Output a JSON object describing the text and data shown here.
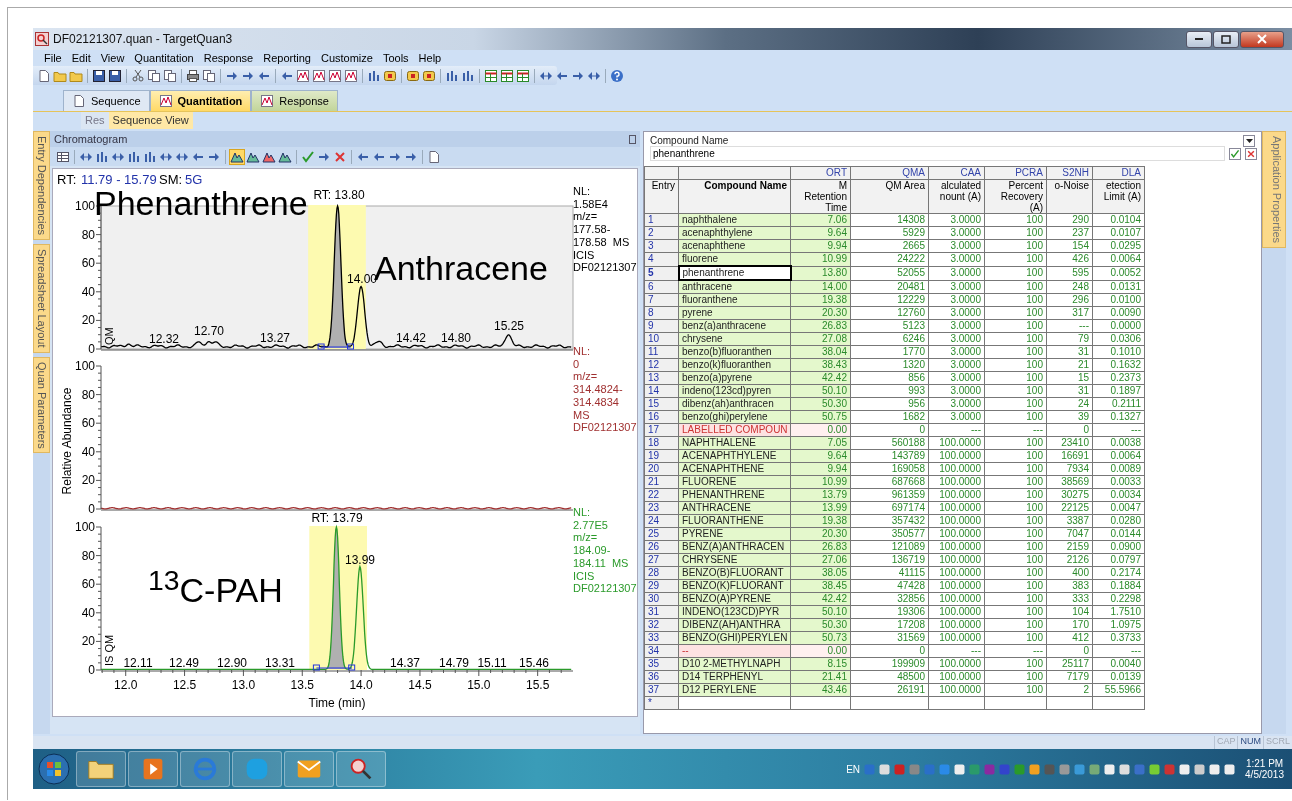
{
  "window": {
    "title": "DF02121307.quan - TargetQuan3"
  },
  "menu": [
    "File",
    "Edit",
    "View",
    "Quantitation",
    "Response",
    "Reporting",
    "Customize",
    "Tools",
    "Help"
  ],
  "tabs": [
    {
      "label": "Sequence",
      "selected": false
    },
    {
      "label": "Quantitation",
      "selected": true
    },
    {
      "label": "Response",
      "selected": false
    }
  ],
  "sub_tabs": [
    {
      "label": "Res",
      "selected": false
    },
    {
      "label": "Sequence View",
      "selected": true
    }
  ],
  "side_tabs": [
    "Entry Dependencies",
    "Spreadsheet Layout",
    "Quan Parameters"
  ],
  "chromatogram": {
    "title": "Chromatogram",
    "range_label": "RT:",
    "range": "11.79 - 15.79",
    "sm_label": "SM:",
    "sm": "5G",
    "ylabel": "Relative Abundance",
    "xlabel": "Time (min)",
    "xticks": [
      "12.0",
      "12.5",
      "13.0",
      "13.5",
      "14.0",
      "14.5",
      "15.0",
      "15.5"
    ],
    "plots": [
      {
        "color": "#000000",
        "yticks": [
          "100",
          "80",
          "60",
          "40",
          "20",
          "0"
        ],
        "axis_label": "QM",
        "rt_label": "RT: 13.80",
        "peak_labels": [
          "14.00",
          "12.32",
          "12.70",
          "13.27",
          "14.42",
          "14.80",
          "15.25"
        ],
        "info": [
          "NL:",
          "1.58E4",
          "m/z=",
          "177.58-",
          "178.58  MS",
          "ICIS",
          "DF02121307"
        ]
      },
      {
        "color": "#a03030",
        "yticks": [
          "100",
          "80",
          "60",
          "40",
          "20",
          "0"
        ],
        "info": [
          "NL:",
          "0",
          "m/z=",
          "314.4824-",
          "314.4834",
          "MS",
          "DF02121307"
        ]
      },
      {
        "color": "#2a9a2a",
        "yticks": [
          "100",
          "80",
          "60",
          "40",
          "20",
          "0"
        ],
        "axis_label": "IS QM",
        "rt_label": "RT: 13.79",
        "peak_labels": [
          "13.99",
          "12.11",
          "12.49",
          "12.90",
          "13.31",
          "14.37",
          "14.79",
          "15.11",
          "15.46"
        ],
        "info": [
          "NL:",
          "2.77E5",
          "m/z=",
          "184.09-",
          "184.11  MS",
          "ICIS",
          "DF02121307"
        ]
      }
    ],
    "annotations": [
      "Phenanthrene",
      "Anthracene",
      "$^{13}$C-PAH"
    ]
  },
  "compound": {
    "label": "Compound Name",
    "value": "phenanthrene"
  },
  "table": {
    "columns": [
      {
        "label": "Entry"
      },
      {
        "label": "Compound Name"
      },
      {
        "code": "ORT",
        "label": "M Retention Time"
      },
      {
        "code": "QMA",
        "label": "QM Area"
      },
      {
        "code": "CAA",
        "label": "alculated nount (A)"
      },
      {
        "code": "PCRA",
        "label": "Percent Recovery (A)"
      },
      {
        "code": "S2NH",
        "label": "o-Noise"
      },
      {
        "code": "DLA",
        "label": "etection Limit (A)"
      }
    ],
    "rows": [
      {
        "entry": "1",
        "name": "naphthalene",
        "values": [
          "7.06",
          "14308",
          "3.0000",
          "100",
          "290",
          "0.0104"
        ],
        "kind": "compound",
        "selected": false
      },
      {
        "entry": "2",
        "name": "acenaphthylene",
        "values": [
          "9.64",
          "5929",
          "3.0000",
          "100",
          "237",
          "0.0107"
        ],
        "kind": "compound",
        "selected": false
      },
      {
        "entry": "3",
        "name": "acenaphthene",
        "values": [
          "9.94",
          "2665",
          "3.0000",
          "100",
          "154",
          "0.0295"
        ],
        "kind": "compound",
        "selected": false
      },
      {
        "entry": "4",
        "name": "fluorene",
        "values": [
          "10.99",
          "24222",
          "3.0000",
          "100",
          "426",
          "0.0064"
        ],
        "kind": "compound",
        "selected": false
      },
      {
        "entry": "5",
        "name": "phenanthrene",
        "values": [
          "13.80",
          "52055",
          "3.0000",
          "100",
          "595",
          "0.0052"
        ],
        "kind": "compound",
        "selected": true
      },
      {
        "entry": "6",
        "name": "anthracene",
        "values": [
          "14.00",
          "20481",
          "3.0000",
          "100",
          "248",
          "0.0131"
        ],
        "kind": "compound",
        "selected": false
      },
      {
        "entry": "7",
        "name": "fluoranthene",
        "values": [
          "19.38",
          "12229",
          "3.0000",
          "100",
          "296",
          "0.0100"
        ],
        "kind": "compound",
        "selected": false
      },
      {
        "entry": "8",
        "name": "pyrene",
        "values": [
          "20.30",
          "12760",
          "3.0000",
          "100",
          "317",
          "0.0090"
        ],
        "kind": "compound",
        "selected": false
      },
      {
        "entry": "9",
        "name": "benz(a)anthracene",
        "values": [
          "26.83",
          "5123",
          "3.0000",
          "100",
          "---",
          "0.0000"
        ],
        "kind": "compound",
        "selected": false
      },
      {
        "entry": "10",
        "name": "chrysene",
        "values": [
          "27.08",
          "6246",
          "3.0000",
          "100",
          "79",
          "0.0306"
        ],
        "kind": "compound",
        "selected": false
      },
      {
        "entry": "11",
        "name": "benzo(b)fluoranthen",
        "values": [
          "38.04",
          "1770",
          "3.0000",
          "100",
          "31",
          "0.1010"
        ],
        "kind": "compound",
        "selected": false
      },
      {
        "entry": "12",
        "name": "benzo(k)fluoranthen",
        "values": [
          "38.43",
          "1320",
          "3.0000",
          "100",
          "21",
          "0.1632"
        ],
        "kind": "compound",
        "selected": false
      },
      {
        "entry": "13",
        "name": "benzo(a)pyrene",
        "values": [
          "42.42",
          "856",
          "3.0000",
          "100",
          "15",
          "0.2373"
        ],
        "kind": "compound",
        "selected": false
      },
      {
        "entry": "14",
        "name": "indeno(123cd)pyren",
        "values": [
          "50.10",
          "993",
          "3.0000",
          "100",
          "31",
          "0.1897"
        ],
        "kind": "compound",
        "selected": false
      },
      {
        "entry": "15",
        "name": "dibenz(ah)anthracen",
        "values": [
          "50.30",
          "956",
          "3.0000",
          "100",
          "24",
          "0.2111"
        ],
        "kind": "compound",
        "selected": false
      },
      {
        "entry": "16",
        "name": "benzo(ghi)perylene",
        "values": [
          "50.75",
          "1682",
          "3.0000",
          "100",
          "39",
          "0.1327"
        ],
        "kind": "compound",
        "selected": false
      },
      {
        "entry": "17",
        "name": "LABELLED COMPOUN",
        "values": [
          "0.00",
          "0",
          "---",
          "---",
          "0",
          "---"
        ],
        "kind": "label",
        "selected": false
      },
      {
        "entry": "18",
        "name": "NAPHTHALENE",
        "values": [
          "7.05",
          "560188",
          "100.0000",
          "100",
          "23410",
          "0.0038"
        ],
        "kind": "compound",
        "selected": false
      },
      {
        "entry": "19",
        "name": "ACENAPHTHYLENE",
        "values": [
          "9.64",
          "143789",
          "100.0000",
          "100",
          "16691",
          "0.0064"
        ],
        "kind": "compound",
        "selected": false
      },
      {
        "entry": "20",
        "name": "ACENAPHTHENE",
        "values": [
          "9.94",
          "169058",
          "100.0000",
          "100",
          "7934",
          "0.0089"
        ],
        "kind": "compound",
        "selected": false
      },
      {
        "entry": "21",
        "name": "FLUORENE",
        "values": [
          "10.99",
          "687668",
          "100.0000",
          "100",
          "38569",
          "0.0033"
        ],
        "kind": "compound",
        "selected": false
      },
      {
        "entry": "22",
        "name": "PHENANTHRENE",
        "values": [
          "13.79",
          "961359",
          "100.0000",
          "100",
          "30275",
          "0.0034"
        ],
        "kind": "compound",
        "selected": false
      },
      {
        "entry": "23",
        "name": "ANTHRACENE",
        "values": [
          "13.99",
          "697174",
          "100.0000",
          "100",
          "22125",
          "0.0047"
        ],
        "kind": "compound",
        "selected": false
      },
      {
        "entry": "24",
        "name": "FLUORANTHENE",
        "values": [
          "19.38",
          "357432",
          "100.0000",
          "100",
          "3387",
          "0.0280"
        ],
        "kind": "compound",
        "selected": false
      },
      {
        "entry": "25",
        "name": "PYRENE",
        "values": [
          "20.30",
          "350577",
          "100.0000",
          "100",
          "7047",
          "0.0144"
        ],
        "kind": "compound",
        "selected": false
      },
      {
        "entry": "26",
        "name": "BENZ(A)ANTHRACEN",
        "values": [
          "26.83",
          "121089",
          "100.0000",
          "100",
          "2159",
          "0.0900"
        ],
        "kind": "compound",
        "selected": false
      },
      {
        "entry": "27",
        "name": "CHRYSENE",
        "values": [
          "27.06",
          "136719",
          "100.0000",
          "100",
          "2126",
          "0.0797"
        ],
        "kind": "compound",
        "selected": false
      },
      {
        "entry": "28",
        "name": "BENZO(B)FLUORANT",
        "values": [
          "38.05",
          "41115",
          "100.0000",
          "100",
          "400",
          "0.2174"
        ],
        "kind": "compound",
        "selected": false
      },
      {
        "entry": "29",
        "name": "BENZO(K)FLUORANT",
        "values": [
          "38.45",
          "47428",
          "100.0000",
          "100",
          "383",
          "0.1884"
        ],
        "kind": "compound",
        "selected": false
      },
      {
        "entry": "30",
        "name": "BENZO(A)PYRENE",
        "values": [
          "42.42",
          "32856",
          "100.0000",
          "100",
          "333",
          "0.2298"
        ],
        "kind": "compound",
        "selected": false
      },
      {
        "entry": "31",
        "name": "INDENO(123CD)PYR",
        "values": [
          "50.10",
          "19306",
          "100.0000",
          "100",
          "104",
          "1.7510"
        ],
        "kind": "compound",
        "selected": false
      },
      {
        "entry": "32",
        "name": "DIBENZ(AH)ANTHRA",
        "values": [
          "50.30",
          "17208",
          "100.0000",
          "100",
          "170",
          "1.0975"
        ],
        "kind": "compound",
        "selected": false
      },
      {
        "entry": "33",
        "name": "BENZO(GHI)PERYLEN",
        "values": [
          "50.73",
          "31569",
          "100.0000",
          "100",
          "412",
          "0.3733"
        ],
        "kind": "compound",
        "selected": false
      },
      {
        "entry": "34",
        "name": "--",
        "values": [
          "0.00",
          "0",
          "---",
          "---",
          "0",
          "---"
        ],
        "kind": "label",
        "selected": false
      },
      {
        "entry": "35",
        "name": "D10 2-METHYLNAPH",
        "values": [
          "8.15",
          "199909",
          "100.0000",
          "100",
          "25117",
          "0.0040"
        ],
        "kind": "compound",
        "selected": false
      },
      {
        "entry": "36",
        "name": "D14 TERPHENYL",
        "values": [
          "21.41",
          "48500",
          "100.0000",
          "100",
          "7179",
          "0.0139"
        ],
        "kind": "compound",
        "selected": false
      },
      {
        "entry": "37",
        "name": "D12 PERYLENE",
        "values": [
          "43.46",
          "26191",
          "100.0000",
          "100",
          "2",
          "55.5966"
        ],
        "kind": "compound",
        "selected": false
      }
    ],
    "new_row": "*"
  },
  "right_tab": "Application Properties",
  "status_bar": [
    {
      "label": "CAP",
      "on": false
    },
    {
      "label": "NUM",
      "on": true
    },
    {
      "label": "SCRL",
      "on": false
    }
  ],
  "taskbar": {
    "language": "EN",
    "time": "1:21 PM",
    "date": "4/5/2013"
  }
}
